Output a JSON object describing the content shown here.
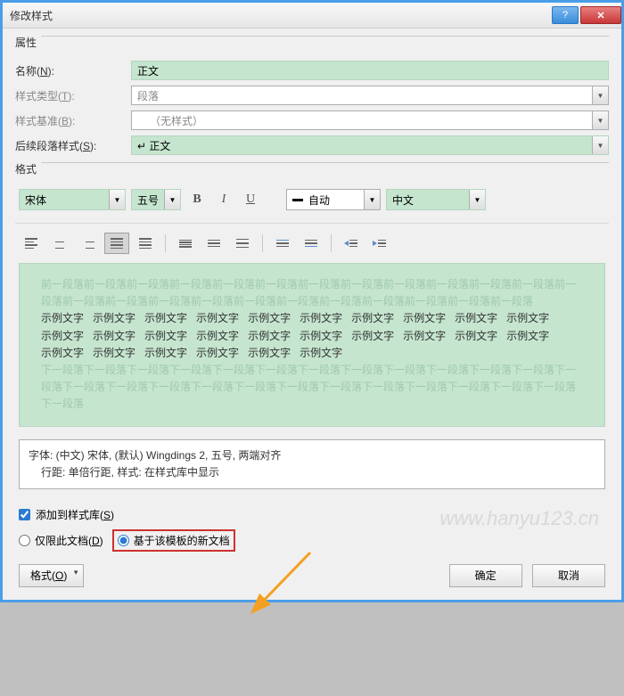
{
  "title": "修改样式",
  "sections": {
    "properties": "属性",
    "format": "格式"
  },
  "labels": {
    "name": "名称(",
    "name_u": "N",
    "name_sfx": "):",
    "styletype": "样式类型(",
    "styletype_u": "T",
    "styletype_sfx": "):",
    "based": "样式基准(",
    "based_u": "B",
    "based_sfx": "):",
    "following": "后续段落样式(",
    "following_u": "S",
    "following_sfx": "):"
  },
  "values": {
    "name": "正文",
    "styletype": "段落",
    "based": "（无样式）",
    "following": "↵ 正文"
  },
  "format_ctrls": {
    "font": "宋体",
    "size": "五号",
    "bold": "B",
    "italic": "I",
    "underline": "U",
    "autocolor": "自动",
    "lang": "中文"
  },
  "preview": {
    "before": "前一段落前一段落前一段落前一段落前一段落前一段落前一段落前一段落前一段落前一段落前一段落前一段落前一段落前一段落前一段落前一段落前一段落前一段落前一段落前一段落前一段落前一段落前一段落前一段落",
    "sample": "示例文字",
    "after": "下一段落下一段落下一段落下一段落下一段落下一段落下一段落下一段落下一段落下一段落下一段落下一段落下一段落下一段落下一段落下一段落下一段落下一段落下一段落下一段落下一段落下一段落下一段落下一段落下一段落下一段落"
  },
  "description": {
    "line1": "字体: (中文) 宋体, (默认) Wingdings 2, 五号, 两端对齐",
    "line2": "行距: 单倍行距, 样式: 在样式库中显示"
  },
  "checkbox": {
    "addto": "添加到样式库(",
    "addto_u": "S",
    "addto_sfx": ")"
  },
  "radio": {
    "onlythis": "仅限此文档(",
    "onlythis_u": "D",
    "onlythis_sfx": ")",
    "newdocs": "基于该模板的新文档"
  },
  "buttons": {
    "format_menu": "格式(",
    "format_menu_u": "O",
    "format_menu_sfx": ")",
    "ok": "确定",
    "cancel": "取消"
  },
  "watermark": "www.hanyu123.cn"
}
